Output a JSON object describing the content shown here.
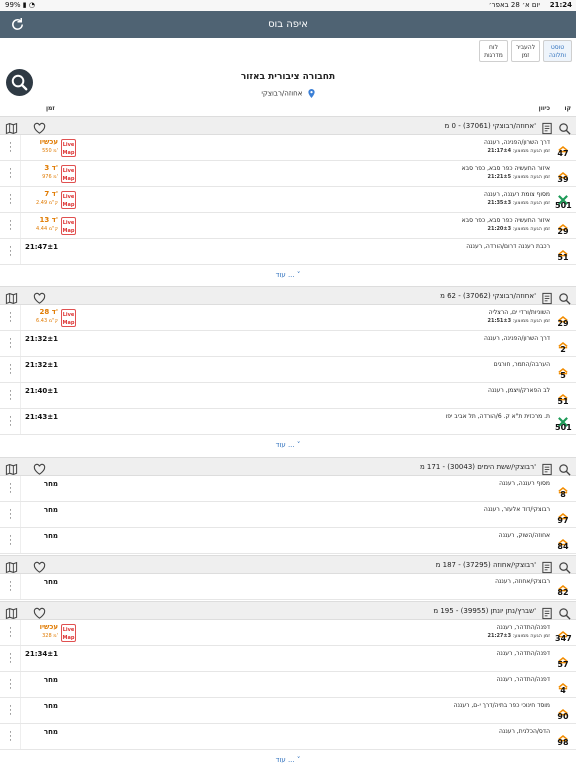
{
  "status": {
    "time": "21:24",
    "date": "יום א׳ 28 באפר׳",
    "battery": "99%"
  },
  "header": {
    "title": "איפה בוס"
  },
  "tabs": [
    {
      "label_line1": "טוסט",
      "label_line2": "ותלונה",
      "active": true
    },
    {
      "label_line1": "להעביר",
      "label_line2": "זמן",
      "active": false
    },
    {
      "label_line1": "לוח",
      "label_line2": "מדרגות",
      "active": false
    }
  ],
  "main": {
    "heading": "תחבורה ציבורית באזור",
    "location": "אחוזה/רבוצקי"
  },
  "columns": {
    "line": "קו",
    "direction": "כיוון",
    "time": "זמן"
  },
  "colors": {
    "accent": "#2d6fbd",
    "live": "#e07a00",
    "header_bg": "#4f6373"
  },
  "live_label": {
    "l1": "Live",
    "l2": "Map"
  },
  "more_label": "עוד ... ˅",
  "sections": [
    {
      "name": "אחוזה/רבוצקי (37061) - 0 מ'",
      "rows": [
        {
          "line": "47",
          "dest": "דרך השרון/הפנינה, רעננה",
          "arr_label": "זמן הגעה ממוצע:",
          "arr": "21:17±4",
          "eta": "עכשיו",
          "dist": "550 מ'",
          "live": true,
          "icon": "dan-icon"
        },
        {
          "line": "39",
          "dest": "איזור התעשיה כפר סבא, כפר סבא",
          "arr_label": "זמן הגעה ממוצע:",
          "arr": "21:21±5",
          "eta": "3 ד'",
          "dist": "976 מ'",
          "live": true,
          "icon": "dan-icon"
        },
        {
          "line": "501",
          "dest": "מסוף צומת רעננה, רעננה",
          "arr_label": "זמן הגעה ממוצע:",
          "arr": "21:35±3",
          "eta": "7 ד'",
          "dist": "2.49 ק\"מ",
          "live": true,
          "icon": "metropoline-icon"
        },
        {
          "line": "29",
          "dest": "איזור התעשיה כפר סבא, כפר סבא",
          "arr_label": "זמן הגעה ממוצע:",
          "arr": "21:20±3",
          "eta": "13 ד'",
          "dist": "4.44 ק\"מ",
          "live": true,
          "icon": "dan-icon"
        },
        {
          "line": "51",
          "dest": "רכבת רעננה דרום/הורדה, רעננה",
          "arr_label": "",
          "arr": "",
          "eta": "21:47±1",
          "dist": "",
          "live": false,
          "icon": "dan-icon"
        }
      ]
    },
    {
      "name": "אחוזה/רבוצקי (37062) - 62 מ'",
      "rows": [
        {
          "line": "29",
          "dest": "השוניות/ורדי ים, הרצליה",
          "arr_label": "זמן הגעה ממוצע:",
          "arr": "21:51±3",
          "eta": "28 ד'",
          "dist": "6.43 ק\"מ",
          "live": true,
          "icon": "dan-icon"
        },
        {
          "line": "2",
          "dest": "דרך השרון/הפנינה, רעננה",
          "arr_label": "",
          "arr": "",
          "eta": "21:32±1",
          "dist": "",
          "live": false,
          "icon": "dan-icon"
        },
        {
          "line": "5",
          "dest": "הערבה/התמר, חורגים",
          "arr_label": "",
          "arr": "",
          "eta": "21:32±1",
          "dist": "",
          "live": false,
          "icon": "dan-icon"
        },
        {
          "line": "51",
          "dest": "לב הפארק/ויצמן, רעננה",
          "arr_label": "",
          "arr": "",
          "eta": "21:40±1",
          "dist": "",
          "live": false,
          "icon": "dan-icon"
        },
        {
          "line": "501",
          "dest": "ת. מרכזית ת\"א ק. 6/הורדה, תל אביב יפו",
          "arr_label": "",
          "arr": "",
          "eta": "21:43±1",
          "dist": "",
          "live": false,
          "icon": "metropoline-icon"
        }
      ]
    },
    {
      "name": "רבוצקי/ששת הימים (30043) - 171 מ'",
      "rows": [
        {
          "line": "8",
          "dest": "מסוף רעננה, רעננה",
          "arr_label": "",
          "arr": "",
          "eta": "מחר",
          "dist": "",
          "live": false,
          "icon": "dan-icon"
        },
        {
          "line": "97",
          "dest": "רבוצקי/דוד אלעזר, רעננה",
          "arr_label": "",
          "arr": "",
          "eta": "מחר",
          "dist": "",
          "live": false,
          "icon": "dan-icon"
        },
        {
          "line": "84",
          "dest": "אחוזה/השוק, רעננה",
          "arr_label": "",
          "arr": "",
          "eta": "מחר",
          "dist": "",
          "live": false,
          "icon": "dan-icon"
        }
      ]
    },
    {
      "name": "רבוצקי/אחוזה (37295) - 187 מ'",
      "rows": [
        {
          "line": "82",
          "dest": "רבוצקי/אחוזה, רעננה",
          "arr_label": "",
          "arr": "",
          "eta": "מחר",
          "dist": "",
          "live": false,
          "icon": "dan-icon"
        }
      ]
    },
    {
      "name": "שברץ/נתן יונתן (39955) - 195 מ'",
      "rows": [
        {
          "line": "347",
          "dest": "דפנה/התדהר, רעננה",
          "arr_label": "זמן הגעה ממוצע:",
          "arr": "21:27±3",
          "eta": "עכשיו",
          "dist": "328 מ'",
          "live": true,
          "icon": "dan-icon"
        },
        {
          "line": "57",
          "dest": "דפנה/התדהר, רעננה",
          "arr_label": "",
          "arr": "",
          "eta": "21:34±1",
          "dist": "",
          "live": false,
          "icon": "dan-icon"
        },
        {
          "line": "4",
          "dest": "דפנה/התדהר, רעננה",
          "arr_label": "",
          "arr": "",
          "eta": "מחר",
          "dist": "",
          "live": false,
          "icon": "dan-icon"
        },
        {
          "line": "90",
          "dest": "מוסד חינוכי כפר בתיה/דרך י-ם, רעננה",
          "arr_label": "",
          "arr": "",
          "eta": "מחר",
          "dist": "",
          "live": false,
          "icon": "dan-icon"
        },
        {
          "line": "98",
          "dest": "הדס/הכלנית, רעננה",
          "arr_label": "",
          "arr": "",
          "eta": "מחר",
          "dist": "",
          "live": false,
          "icon": "dan-icon"
        }
      ]
    }
  ]
}
